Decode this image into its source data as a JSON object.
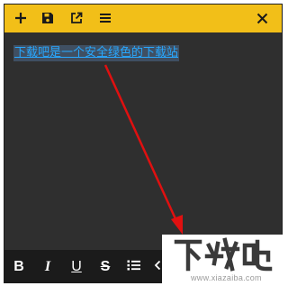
{
  "toolbar": {
    "buttons": [
      {
        "name": "add-icon"
      },
      {
        "name": "save-icon"
      },
      {
        "name": "external-open-icon"
      },
      {
        "name": "menu-icon"
      },
      {
        "name": "close-icon"
      }
    ],
    "color": "#f2bf18"
  },
  "editor": {
    "text": "下载吧是一个安全绿色的下载站",
    "text_color": "#28a8ff",
    "selection_color": "#3f4f62",
    "background": "#2f2f2f"
  },
  "format_bar": {
    "bold_label": "B",
    "italic_label": "I",
    "underline_label": "U",
    "strike_label": "S",
    "more_icon": "chevron-left-icon",
    "list_icon": "bulleted-list-icon"
  },
  "watermark": {
    "logo_text": "下载吧",
    "url": "www.xiazaiba.com"
  },
  "annotation": {
    "arrow_color": "#e01010"
  }
}
